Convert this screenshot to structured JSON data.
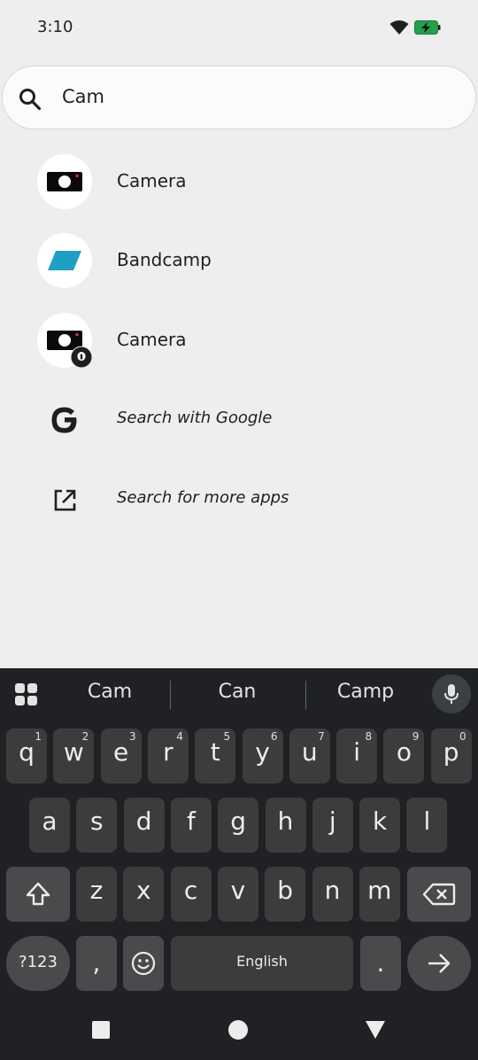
{
  "status_bar": {
    "time": "3:10",
    "wifi_icon": "wifi-icon",
    "battery_icon": "battery-charging-icon"
  },
  "search": {
    "query": "Cam",
    "icon": "search-icon"
  },
  "results": [
    {
      "label": "Camera",
      "icon": "camera-app-icon"
    },
    {
      "label": "Bandcamp",
      "icon": "bandcamp-app-icon"
    },
    {
      "label": "Camera",
      "icon": "camera-work-app-icon"
    },
    {
      "label": "Search with Google",
      "icon": "google-g-icon"
    },
    {
      "label": "Search for more apps",
      "icon": "open-external-icon"
    }
  ],
  "keyboard": {
    "suggestions": [
      "Cam",
      "Can",
      "Camp"
    ],
    "row1": [
      {
        "ch": "q",
        "num": "1"
      },
      {
        "ch": "w",
        "num": "2"
      },
      {
        "ch": "e",
        "num": "3"
      },
      {
        "ch": "r",
        "num": "4"
      },
      {
        "ch": "t",
        "num": "5"
      },
      {
        "ch": "y",
        "num": "6"
      },
      {
        "ch": "u",
        "num": "7"
      },
      {
        "ch": "i",
        "num": "8"
      },
      {
        "ch": "o",
        "num": "9"
      },
      {
        "ch": "p",
        "num": "0"
      }
    ],
    "row2": [
      "a",
      "s",
      "d",
      "f",
      "g",
      "h",
      "j",
      "k",
      "l"
    ],
    "row3": [
      "z",
      "x",
      "c",
      "v",
      "b",
      "n",
      "m"
    ],
    "symbols_label": "?123",
    "comma": ",",
    "space_label": "English",
    "period": ".",
    "accent_color": "#8ab4f8"
  }
}
